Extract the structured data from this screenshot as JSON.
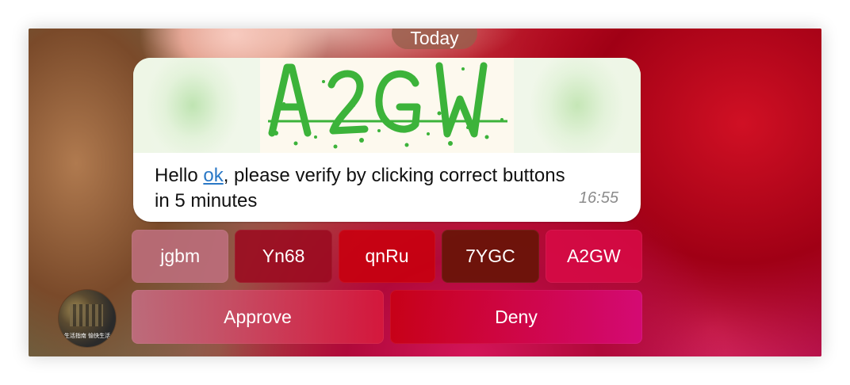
{
  "header": {
    "date_label": "Today"
  },
  "message": {
    "text_before": "Hello ",
    "mention": "ok",
    "text_after": ", please verify by clicking correct buttons in 5 minutes",
    "time": "16:55",
    "captcha": {
      "text": "A2GW",
      "glyph_color": "#3cb33a"
    }
  },
  "keyboard": {
    "options": [
      "jgbm",
      "Yn68",
      "qnRu",
      "7YGC",
      "A2GW"
    ],
    "approve_label": "Approve",
    "deny_label": "Deny"
  },
  "avatar": {
    "caption": "生活指南 愉快生活"
  },
  "colors": {
    "link": "#2a78c6",
    "timestamp": "#8c8c8c",
    "bubble": "#ffffff"
  }
}
